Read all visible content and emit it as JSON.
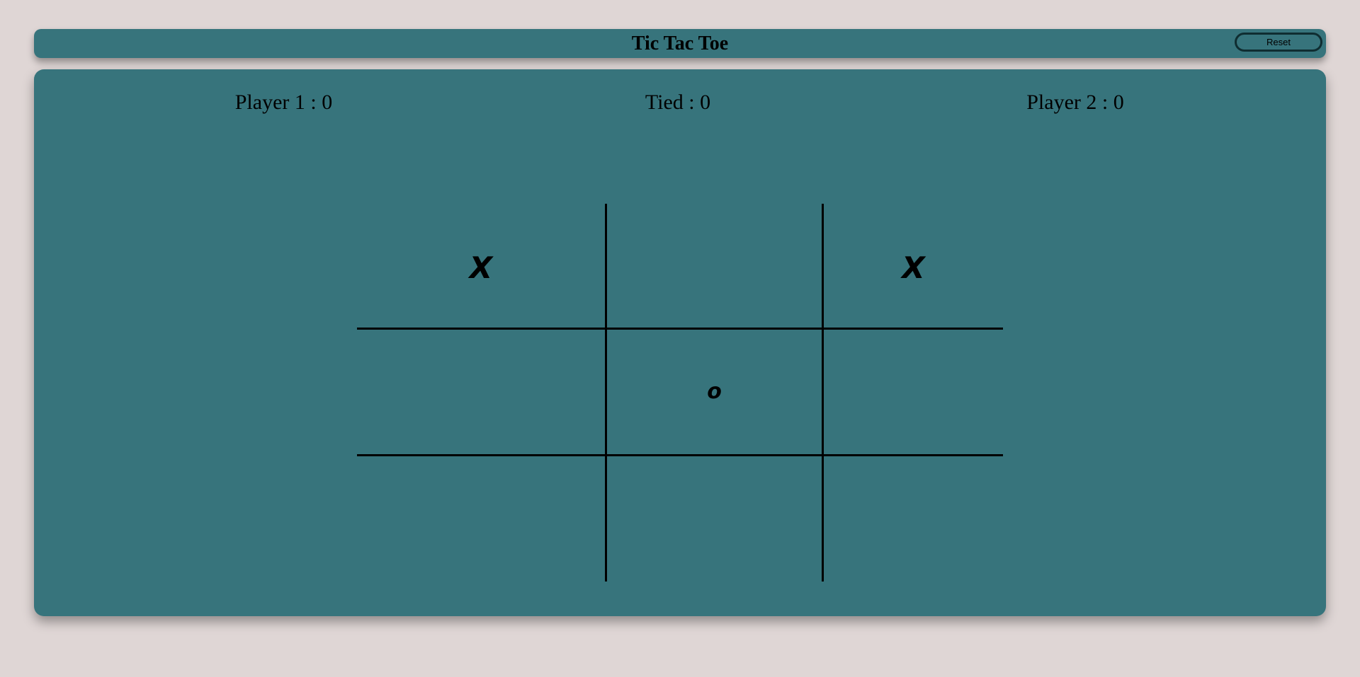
{
  "header": {
    "title": "Tic Tac Toe",
    "reset_label": "Reset"
  },
  "scores": {
    "player1": "Player 1 : 0",
    "tied": "Tied : 0",
    "player2": "Player 2 : 0"
  },
  "board": {
    "cells": [
      "X",
      "",
      "X",
      "",
      "o",
      "",
      "",
      "",
      ""
    ]
  },
  "colors": {
    "background": "#dfd6d5",
    "panel": "#37747c",
    "ink": "#000000"
  }
}
